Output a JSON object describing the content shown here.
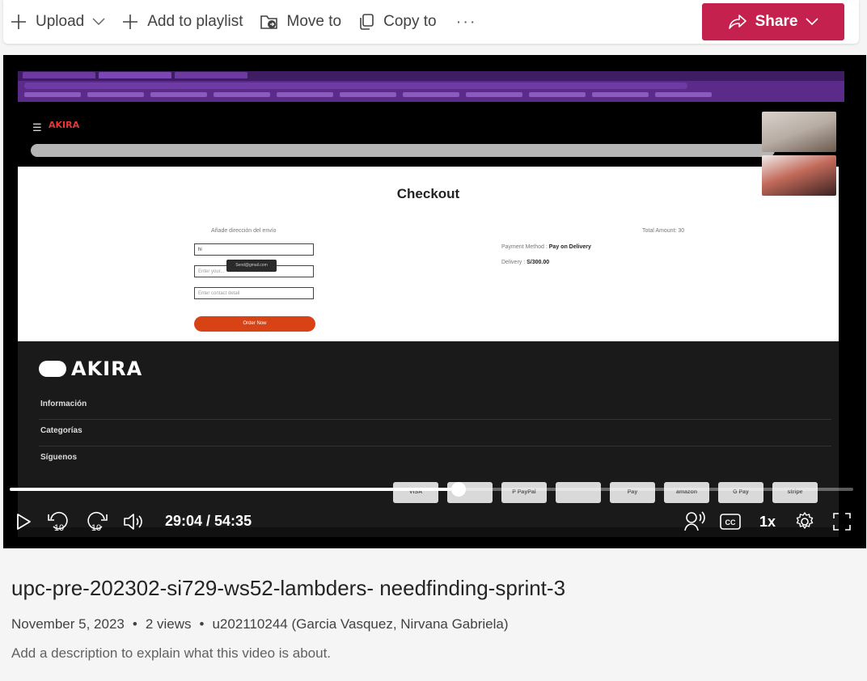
{
  "toolbar": {
    "upload_label": "Upload",
    "add_to_playlist_label": "Add to playlist",
    "move_to_label": "Move to",
    "copy_to_label": "Copy to",
    "more_label": "···",
    "share_label": "Share"
  },
  "video_content": {
    "site_logo_small": "AKIRA",
    "checkout_title": "Checkout",
    "address_label": "Añade dirección del envío",
    "address_value": "hi",
    "input2_placeholder": "Enter your...",
    "input3_placeholder": "Enter contact detail",
    "tooltip": "Send@gmail.com",
    "order_button": "Order Now",
    "total_amount": "Total Amount: 30",
    "payment_method_label": "Payment Method :",
    "payment_method_value": "Pay on Delivery",
    "delivery_label": "Delivery :",
    "delivery_value": "S/300.00",
    "footer_logo": "AKIRA",
    "footer_links": [
      "Información",
      "Categorías",
      "Síguenos"
    ],
    "payment_icons": [
      "VISA",
      "",
      "P PayPal",
      "",
      "Pay",
      "amazon",
      "G Pay",
      "stripe"
    ]
  },
  "player": {
    "current_time": "29:04",
    "duration": "54:35",
    "time_display": "29:04 / 54:35",
    "progress_fraction": 0.532,
    "speed": "1x",
    "rewind_seconds": "10",
    "forward_seconds": "10"
  },
  "video_info": {
    "title": "upc-pre-202302-si729-ws52-lambders- needfinding-sprint-3",
    "date": "November 5, 2023",
    "views": "2 views",
    "owner": "u202110244 (Garcia Vasquez, Nirvana Gabriela)",
    "description_placeholder": "Add a description to explain what this video is about."
  },
  "colors": {
    "share_bg": "#c4214f",
    "order_button": "#d84315",
    "browser_chrome": "#5b2b8a"
  }
}
